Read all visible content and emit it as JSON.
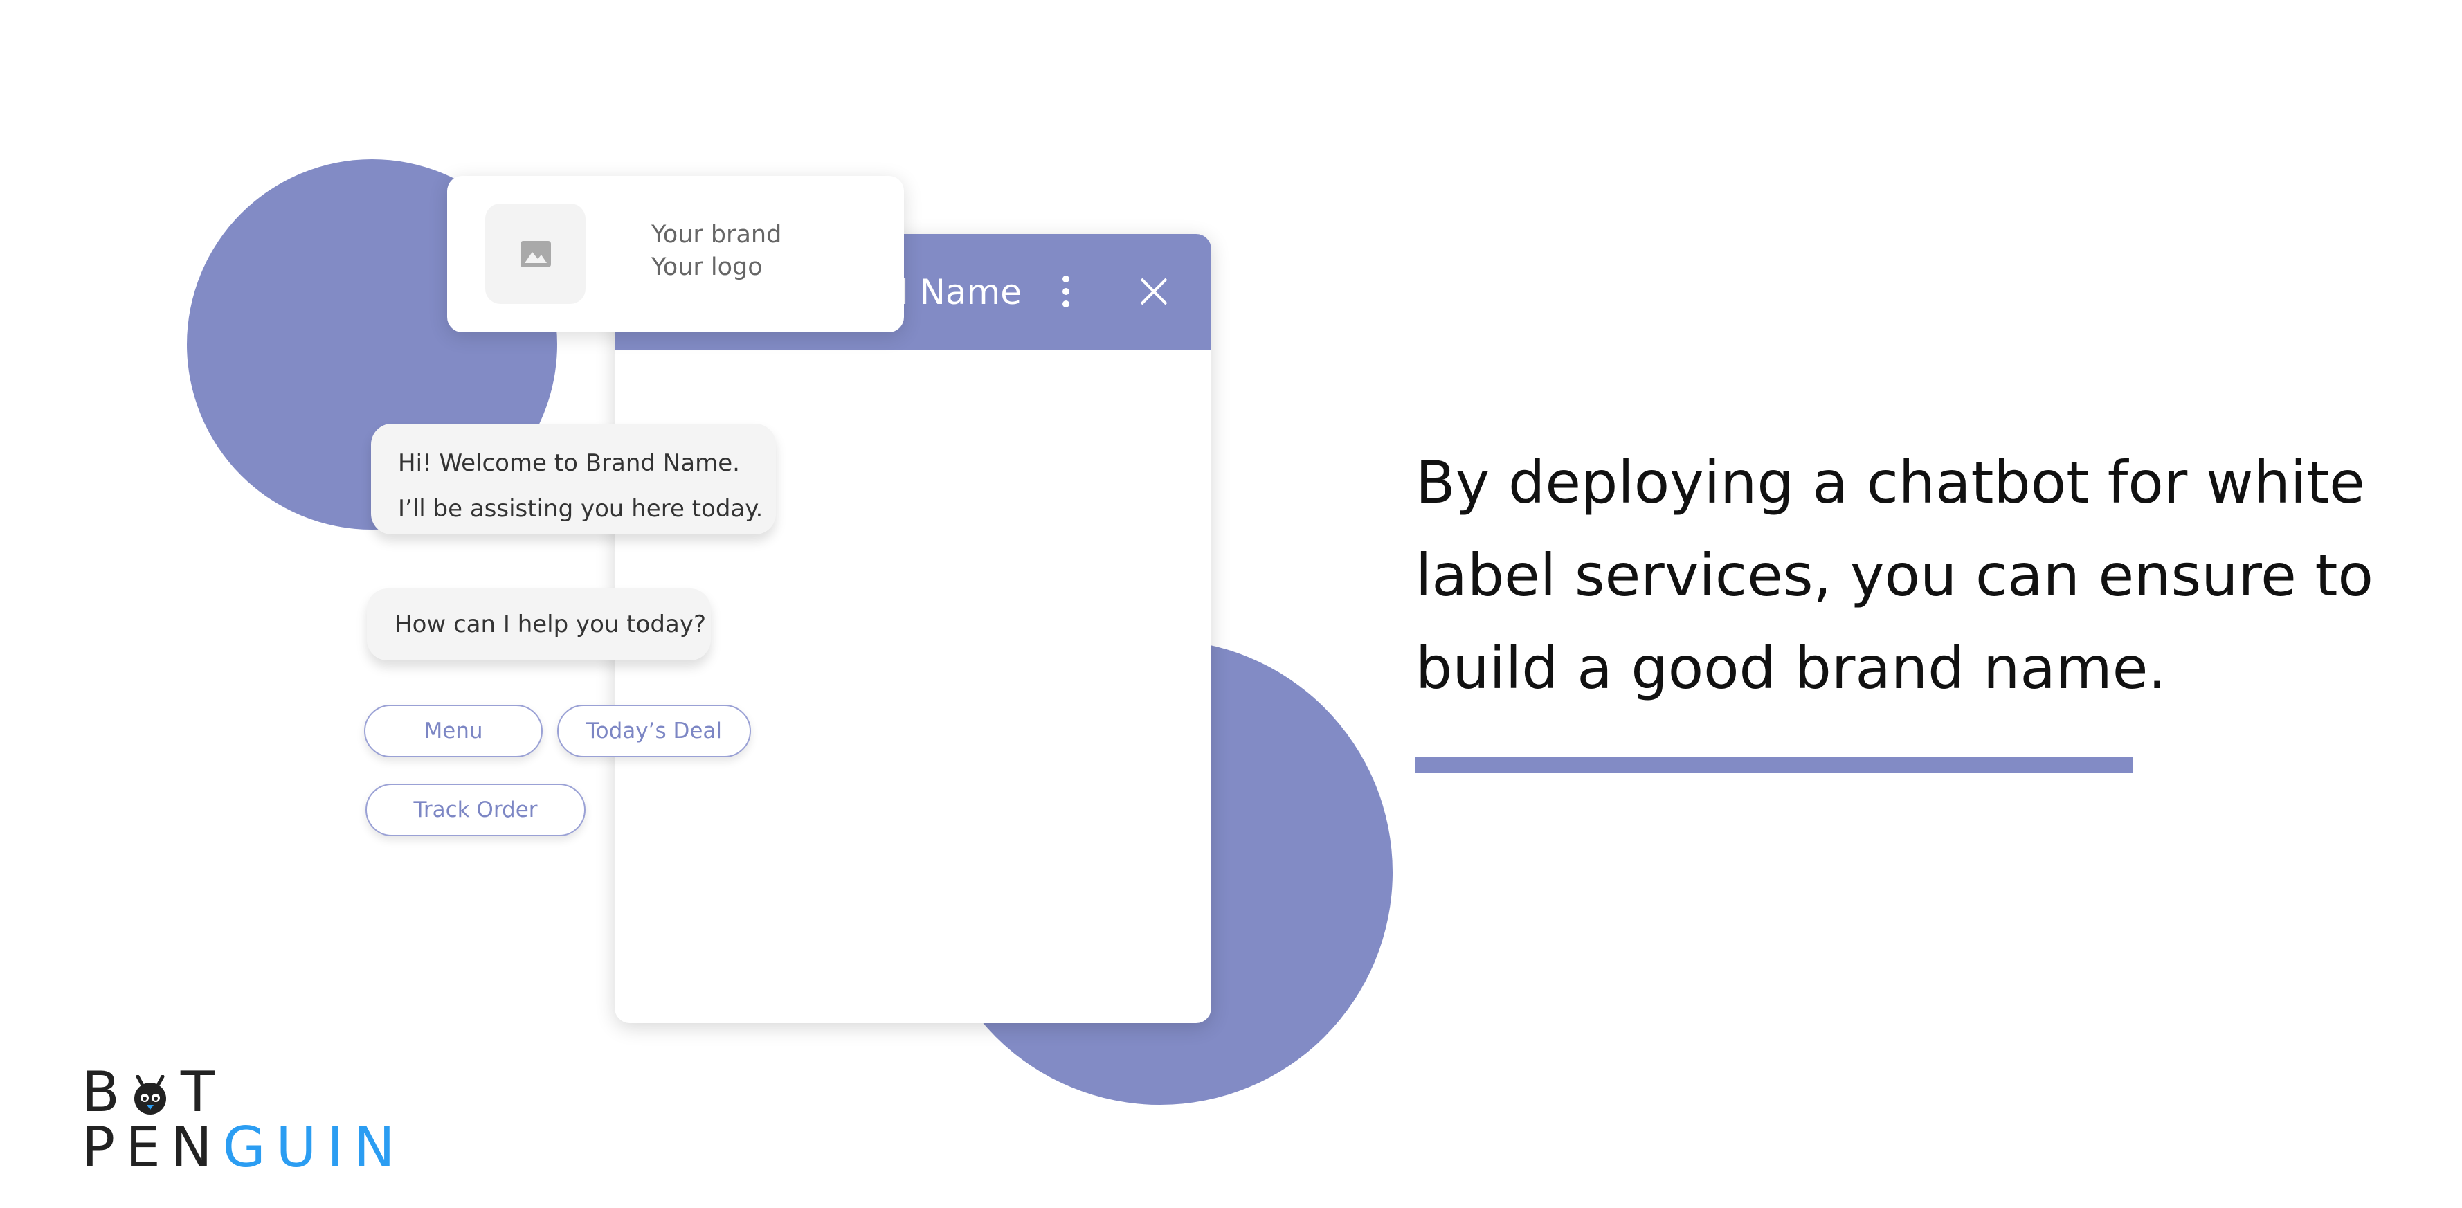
{
  "colors": {
    "accent": "#828bc5",
    "chip_text": "#7c86c4",
    "logo_blue": "#2b9df2",
    "text_dark": "#111111"
  },
  "chat_window": {
    "title_partial": "Brand Name",
    "menu_icon": "kebab-icon",
    "close_icon": "close-icon"
  },
  "brand_card": {
    "icon": "image-icon",
    "line1": "Your brand",
    "line2": "Your logo"
  },
  "messages": [
    {
      "line1": "Hi! Welcome to Brand Name.",
      "line2": "I’ll be assisting you here today."
    },
    {
      "line1": "How can I help you today?"
    }
  ],
  "quick_replies": [
    "Menu",
    "Today’s Deal",
    "Track Order"
  ],
  "headline": {
    "line1": "By deploying a chatbot for white",
    "line2": "label services, you can ensure to",
    "line3": "build a good brand name."
  },
  "logo": {
    "line1_prefix": "B",
    "line1_suffix": "T",
    "line2_dark": "PEN",
    "line2_blue": "GUIN"
  }
}
